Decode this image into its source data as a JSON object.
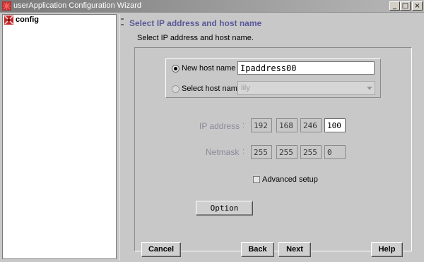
{
  "window": {
    "title": "userApplication Configuration Wizard",
    "controls": {
      "minimize": "_",
      "maximize": "□",
      "close": "×"
    }
  },
  "tree": {
    "root_label": "config",
    "root_icon": "config-node-icon"
  },
  "page": {
    "heading": "Select IP address and host name",
    "subheading": "Select IP address and host name."
  },
  "host": {
    "new_host_label": "New host name",
    "new_host_value": "Ipaddress00",
    "new_host_selected": true,
    "select_host_label": "Select host name",
    "select_host_value": "lily",
    "select_host_enabled": false
  },
  "ip": {
    "label": "IP address",
    "separator": ":",
    "octets": [
      "192",
      "168",
      "246",
      "100"
    ]
  },
  "netmask": {
    "label": "Netmask",
    "separator": ":",
    "octets": [
      "255",
      "255",
      "255",
      "0"
    ]
  },
  "advanced": {
    "label": "Advanced setup",
    "checked": false
  },
  "buttons": {
    "option": "Option",
    "cancel": "Cancel",
    "back": "Back",
    "next": "Next",
    "help": "Help"
  },
  "colors": {
    "heading": "#5a5a9a",
    "panel_bg": "#c8c8c8",
    "disabled_text": "#8a8a9a"
  }
}
